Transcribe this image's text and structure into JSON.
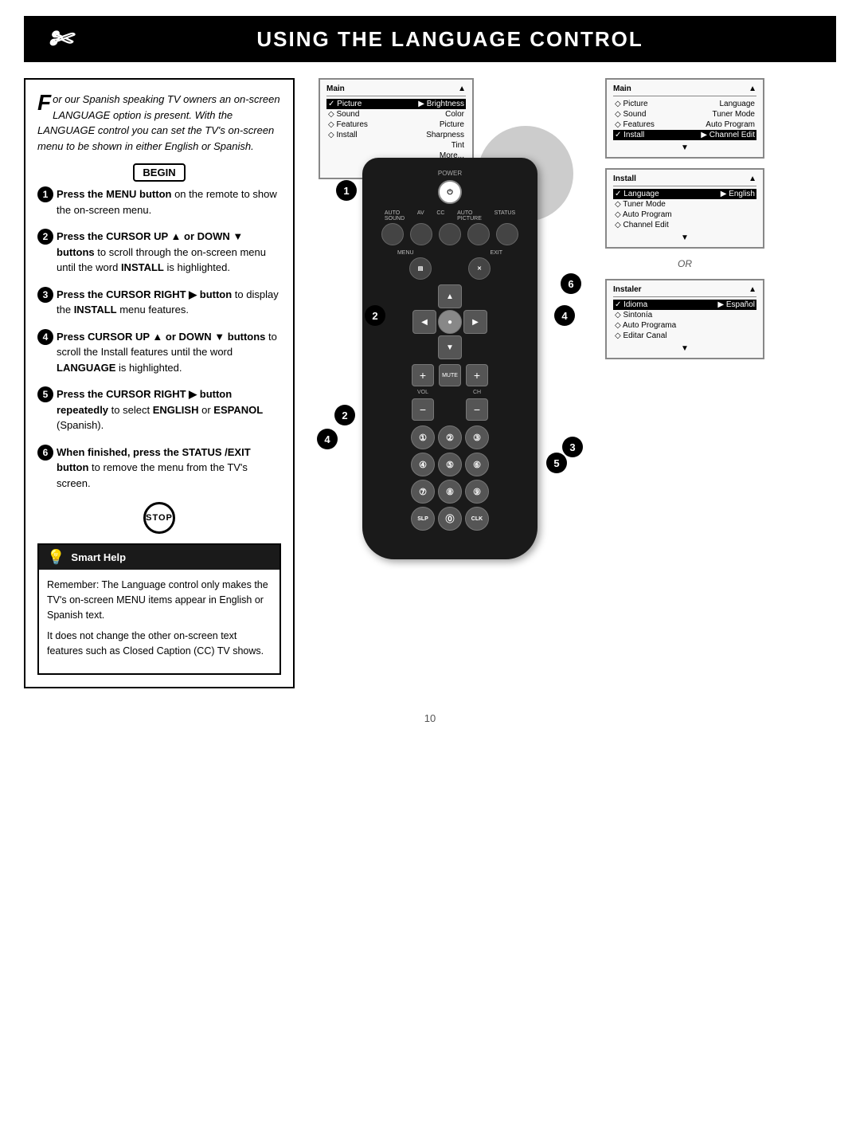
{
  "header": {
    "title": "Using the Language Control",
    "icon": "✄"
  },
  "intro": {
    "large_letter": "F",
    "text": "or our Spanish speaking TV owners an on-screen LANGUAGE option is present. With the LANGUAGE control you can set the TV's on-screen menu to be shown in either English or Spanish."
  },
  "begin_label": "BEGIN",
  "stop_label": "STOP",
  "steps": [
    {
      "num": "1",
      "bold": "Press the MENU button",
      "rest": " on the remote to show the on-screen menu."
    },
    {
      "num": "2",
      "bold": "Press the CURSOR UP ▲ or DOWN ▼ buttons",
      "rest": " to scroll through the on-screen menu until the word INSTALL is highlighted."
    },
    {
      "num": "3",
      "bold": "Press the CURSOR RIGHT ▶ button",
      "rest": " to display the INSTALL menu features."
    },
    {
      "num": "4",
      "bold": "Press CURSOR UP ▲ or DOWN ▼ buttons",
      "rest": " to scroll the Install features until the word LANGUAGE is highlighted."
    },
    {
      "num": "5",
      "bold": "Press the CURSOR RIGHT ▶ button repeatedly",
      "rest": " to select ENGLISH or ESPANOL (Spanish)."
    },
    {
      "num": "6",
      "bold": "When finished, press the STATUS /EXIT button",
      "rest": " to remove the menu from the TV's screen."
    }
  ],
  "smart_help": {
    "title": "Smart Help",
    "body1": "Remember: The Language control only makes the TV's on-screen MENU items appear in English or Spanish text.",
    "body2": "It does not change the other on-screen text features such as Closed Caption (CC) TV shows."
  },
  "tv_menu1": {
    "header_left": "Main",
    "header_right": "▲",
    "rows": [
      {
        "label": "✓ Picture",
        "value": "▶  Brightness",
        "selected": true
      },
      {
        "label": "◇ Sound",
        "value": "Color"
      },
      {
        "label": "◇ Features",
        "value": "Picture"
      },
      {
        "label": "◇ Install",
        "value": "Sharpness"
      },
      {
        "label": "",
        "value": "Tint"
      },
      {
        "label": "",
        "value": "More..."
      }
    ],
    "footer": "▼"
  },
  "screen2": {
    "header_left": "Main",
    "header_right": "▲",
    "rows": [
      {
        "label": "◇ Picture",
        "value": "Language"
      },
      {
        "label": "◇ Sound",
        "value": "Tuner Mode"
      },
      {
        "label": "◇ Features",
        "value": "Auto Program"
      },
      {
        "label": "✓ Install",
        "value": "▶  Channel Edit",
        "selected": true
      }
    ],
    "footer": "▼"
  },
  "screen3": {
    "header_left": "Install",
    "header_right": "▲",
    "rows": [
      {
        "label": "✓ Language",
        "value": "▶  English",
        "selected": true
      },
      {
        "label": "◇ Tuner Mode",
        "value": ""
      },
      {
        "label": "◇ Auto Program",
        "value": ""
      },
      {
        "label": "◇ Channel Edit",
        "value": ""
      }
    ],
    "footer": "▼"
  },
  "or_label": "OR",
  "screen4": {
    "header_left": "Instaler",
    "header_right": "▲",
    "rows": [
      {
        "label": "✓ Idioma",
        "value": "▶  Español",
        "selected": true
      },
      {
        "label": "◇ Sintonía",
        "value": ""
      },
      {
        "label": "◇ Auto Programa",
        "value": ""
      },
      {
        "label": "◇ Editar Canal",
        "value": ""
      }
    ],
    "footer": "▼"
  },
  "remote": {
    "power_label": "POWER",
    "buttons": {
      "auto_sound": "AUTO\nSOUND",
      "av": "AV",
      "cc": "CC",
      "auto_picture": "AUTO\nPICTURE",
      "status": "STATUS",
      "menu": "MENU",
      "exit": "EXIT",
      "mute": "MUTE",
      "ch": "CH",
      "sleep": "SLEEP",
      "clock": "CLOCK"
    },
    "numpad": [
      "1",
      "2",
      "3",
      "4",
      "5",
      "6",
      "7",
      "8",
      "9",
      "",
      "0",
      ""
    ]
  },
  "page_number": "10",
  "step_cursor_up_down": "Press CURSOR UP or DOWN"
}
